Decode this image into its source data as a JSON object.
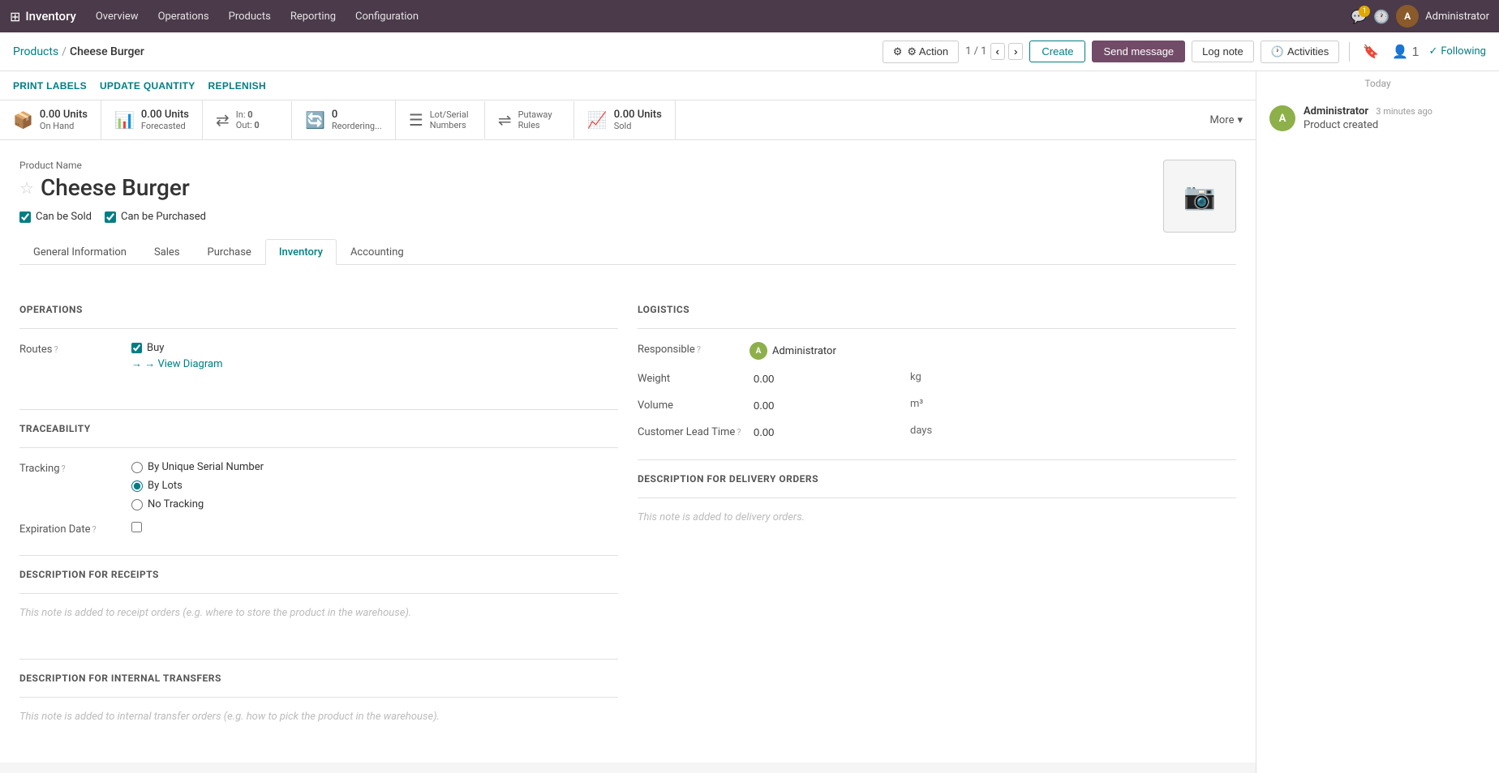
{
  "topnav": {
    "app_name": "Inventory",
    "menu_items": [
      "Overview",
      "Operations",
      "Products",
      "Reporting",
      "Configuration"
    ],
    "user": "Administrator",
    "badge_count": "1"
  },
  "breadcrumb": {
    "parent": "Products",
    "current": "Cheese Burger"
  },
  "nav": {
    "position": "1 / 1",
    "action_label": "⚙ Action",
    "create_label": "Create"
  },
  "header_buttons": {
    "send_message": "Send message",
    "log_note": "Log note",
    "activities": "Activities"
  },
  "right_buttons": {
    "followers": "1",
    "following": "Following"
  },
  "action_bar": {
    "print_labels": "PRINT LABELS",
    "update_quantity": "UPDATE QUANTITY",
    "replenish": "REPLENISH"
  },
  "stats": {
    "on_hand": {
      "value": "0.00 Units",
      "label": "On Hand"
    },
    "forecasted": {
      "value": "0.00 Units",
      "label": "Forecasted"
    },
    "in": {
      "value": "0",
      "label": "In"
    },
    "out": {
      "value": "0",
      "label": "Out"
    },
    "reordering": {
      "value": "0",
      "label": "Reordering..."
    },
    "lot_serial": {
      "label": "Lot/Serial\nNumbers"
    },
    "putaway": {
      "label": "Putaway\nRules"
    },
    "units_sold": {
      "value": "0.00 Units",
      "label": "Sold"
    },
    "more": "More"
  },
  "product": {
    "name_label": "Product Name",
    "title": "Cheese Burger",
    "can_be_sold": true,
    "can_be_sold_label": "Can be Sold",
    "can_be_purchased": true,
    "can_be_purchased_label": "Can be Purchased"
  },
  "tabs": {
    "items": [
      "General Information",
      "Sales",
      "Purchase",
      "Inventory",
      "Accounting"
    ],
    "active": "Inventory"
  },
  "inventory_tab": {
    "operations_section": "OPERATIONS",
    "logistics_section": "LOGISTICS",
    "traceability_section": "TRACEABILITY",
    "routes_label": "Routes",
    "buy_checked": true,
    "buy_label": "Buy",
    "view_diagram_label": "→ View Diagram",
    "responsible_label": "Responsible",
    "responsible_name": "Administrator",
    "weight_label": "Weight",
    "weight_value": "0.00",
    "weight_unit": "kg",
    "volume_label": "Volume",
    "volume_value": "0.00",
    "volume_unit": "m³",
    "customer_lead_time_label": "Customer Lead Time",
    "customer_lead_time_value": "0.00",
    "customer_lead_time_unit": "days",
    "tracking_label": "Tracking",
    "tracking_options": [
      "By Unique Serial Number",
      "By Lots",
      "No Tracking"
    ],
    "tracking_selected": "By Lots",
    "expiration_date_label": "Expiration Date",
    "desc_receipts_label": "DESCRIPTION FOR RECEIPTS",
    "desc_receipts_placeholder": "This note is added to receipt orders (e.g. where to store the product in the warehouse).",
    "desc_delivery_label": "DESCRIPTION FOR DELIVERY ORDERS",
    "desc_delivery_placeholder": "This note is added to delivery orders.",
    "desc_internal_label": "DESCRIPTION FOR INTERNAL TRANSFERS",
    "desc_internal_placeholder": "This note is added to internal transfer orders (e.g. how to pick the product in the warehouse)."
  },
  "chatter": {
    "today_label": "Today",
    "messages": [
      {
        "author": "Administrator",
        "avatar_letter": "A",
        "time": "3 minutes ago",
        "text": "Product created"
      }
    ]
  }
}
